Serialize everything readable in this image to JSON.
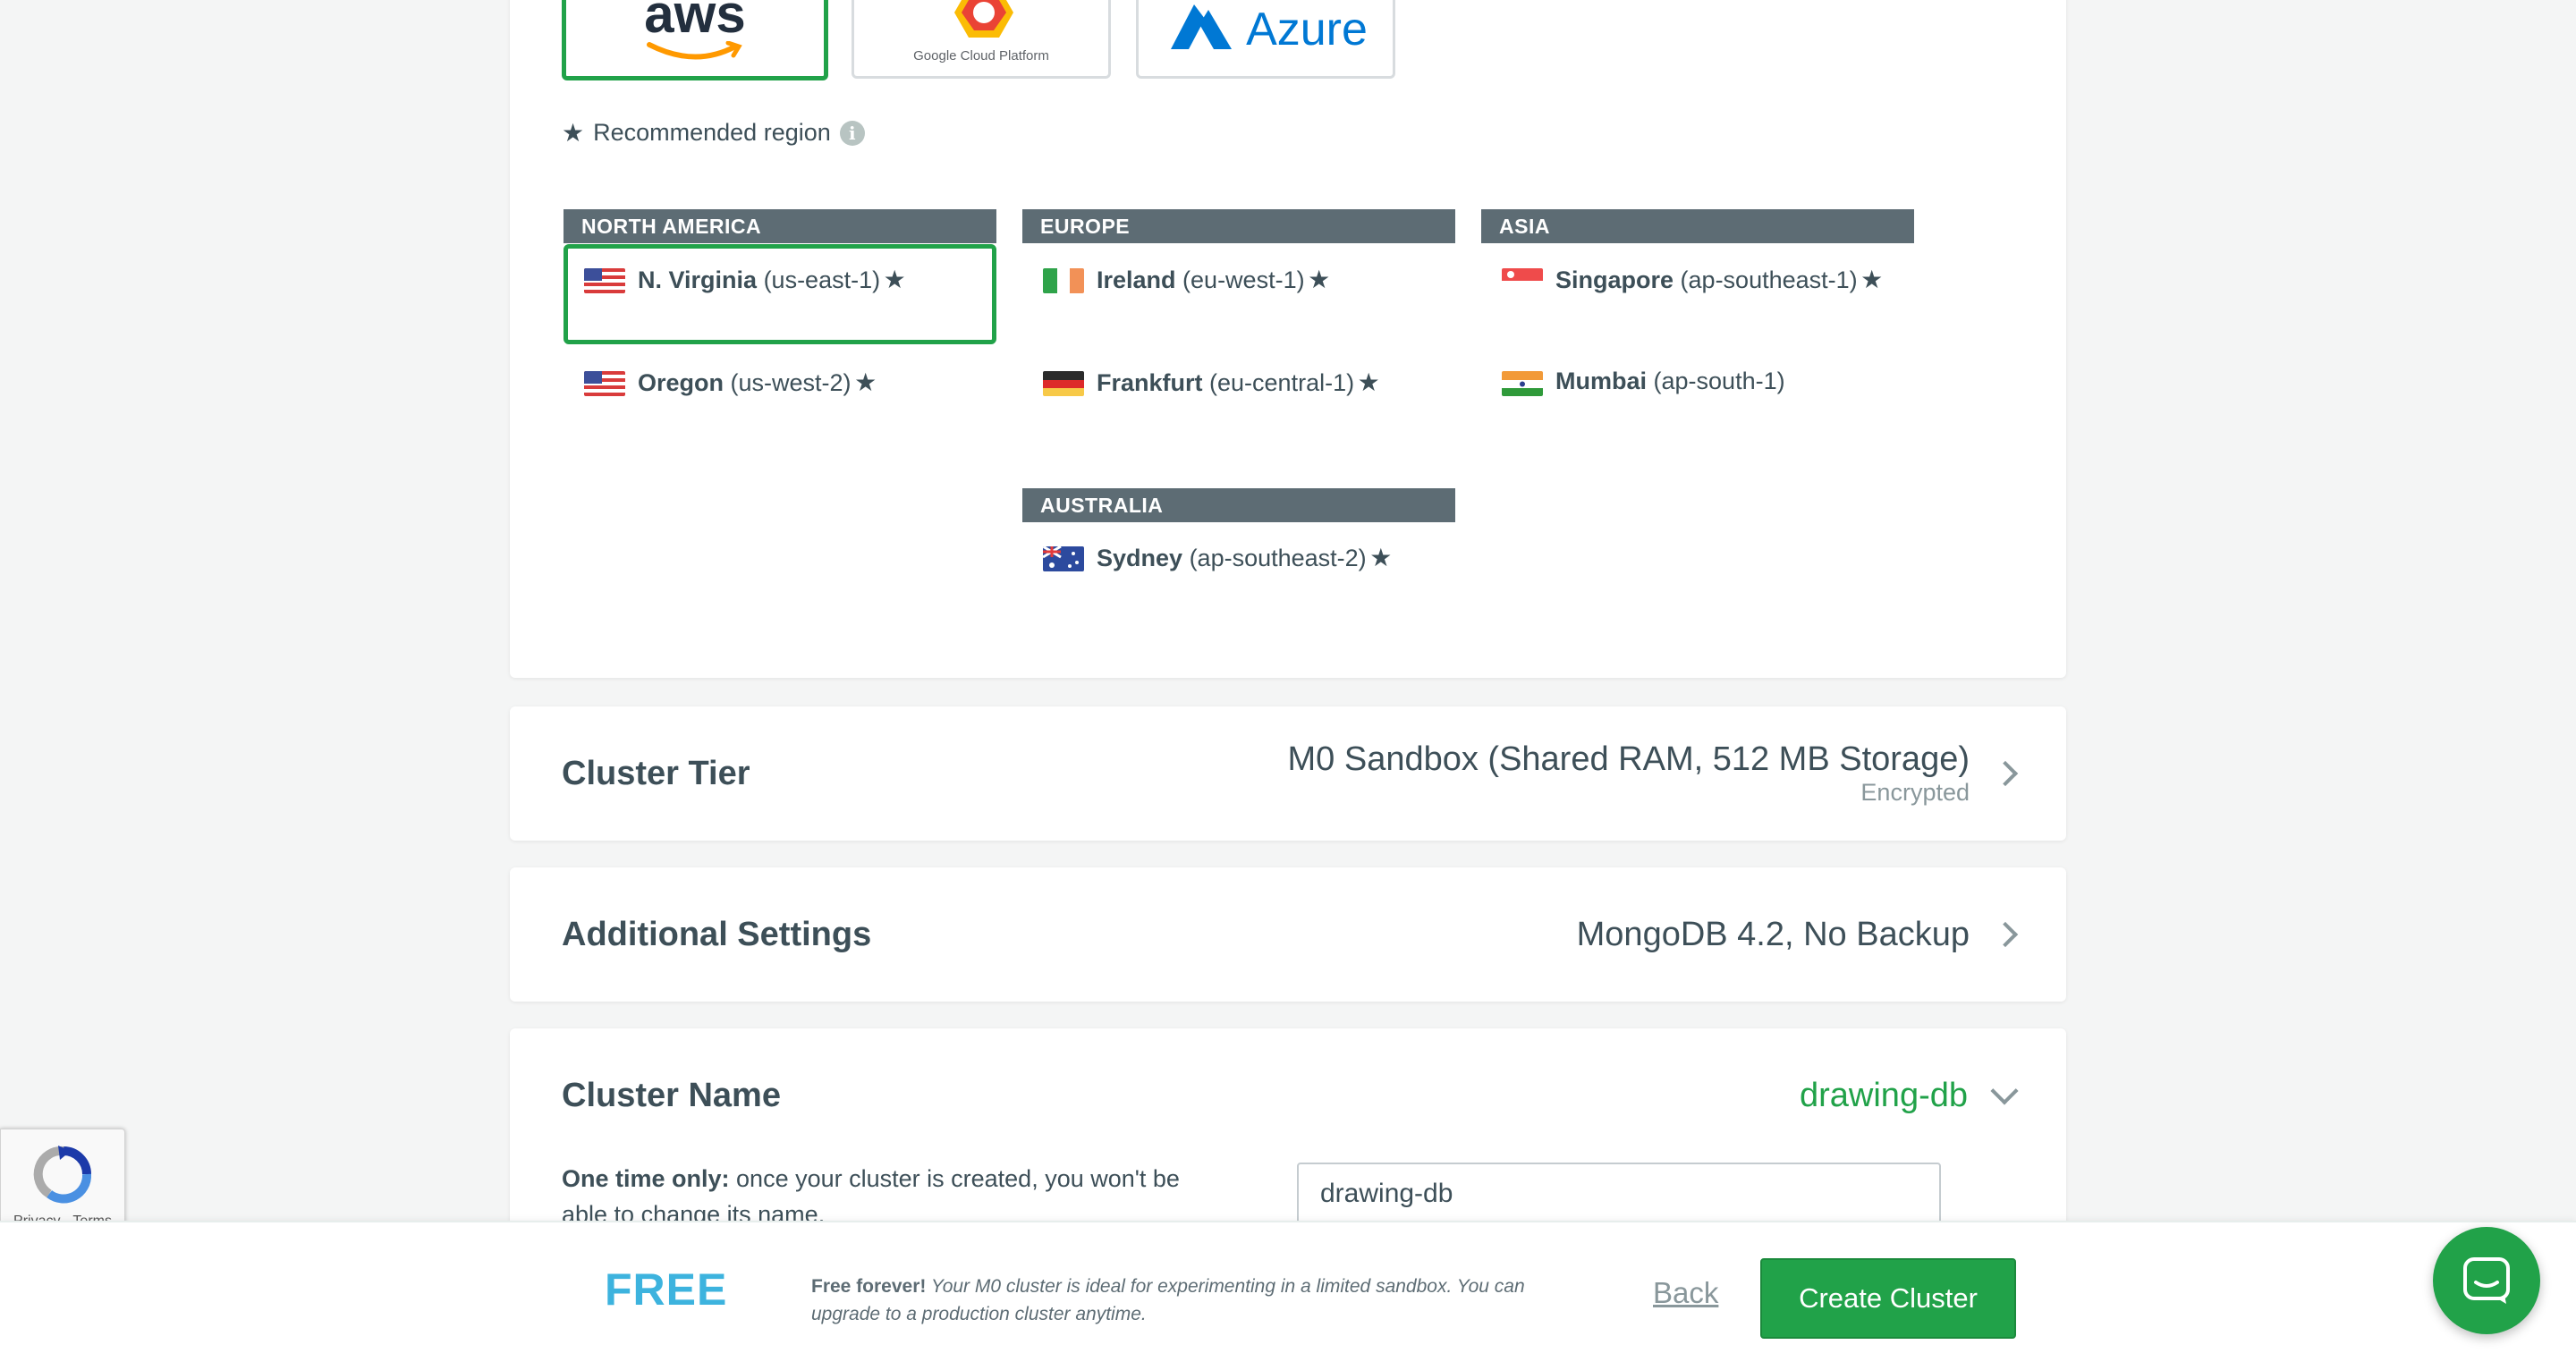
{
  "providers": {
    "aws": {
      "label": "aws",
      "selected": true
    },
    "gcp": {
      "label": "Google Cloud Platform"
    },
    "azure": {
      "label": "Azure"
    }
  },
  "recommended": {
    "label": "Recommended region"
  },
  "regions": {
    "north_america": {
      "header": "NORTH AMERICA",
      "items": [
        {
          "name": "N. Virginia",
          "code": "(us-east-1)",
          "recommended": true,
          "flag": "us-flag",
          "selected": true
        },
        {
          "name": "Oregon",
          "code": "(us-west-2)",
          "recommended": true,
          "flag": "us-flag"
        }
      ]
    },
    "europe": {
      "header": "EUROPE",
      "items": [
        {
          "name": "Ireland",
          "code": "(eu-west-1)",
          "recommended": true,
          "flag": "ireland-flag"
        },
        {
          "name": "Frankfurt",
          "code": "(eu-central-1)",
          "recommended": true,
          "flag": "germany-flag"
        }
      ]
    },
    "asia": {
      "header": "ASIA",
      "items": [
        {
          "name": "Singapore",
          "code": "(ap-southeast-1)",
          "recommended": true,
          "flag": "singapore-flag"
        },
        {
          "name": "Mumbai",
          "code": "(ap-south-1)",
          "recommended": false,
          "flag": "india-flag"
        }
      ]
    },
    "australia": {
      "header": "AUSTRALIA",
      "items": [
        {
          "name": "Sydney",
          "code": "(ap-southeast-2)",
          "recommended": true,
          "flag": "australia-flag"
        }
      ]
    }
  },
  "cluster_tier": {
    "title": "Cluster Tier",
    "value": "M0 Sandbox (Shared RAM, 512 MB Storage)",
    "sub": "Encrypted"
  },
  "additional_settings": {
    "title": "Additional Settings",
    "value": "MongoDB 4.2, No Backup"
  },
  "cluster_name": {
    "title": "Cluster Name",
    "value": "drawing-db",
    "note_bold": "One time only:",
    "note_text": " once your cluster is created, you won't be able to change its name.",
    "input_value": "drawing-db"
  },
  "footer": {
    "tier_label": "FREE",
    "desc_bold": "Free forever!",
    "desc_text": " Your M0 cluster is ideal for experimenting in a limited sandbox. You can upgrade to a production cluster anytime.",
    "back_label": "Back",
    "create_label": "Create Cluster"
  },
  "recaptcha": {
    "links": "Privacy - Terms"
  },
  "colors": {
    "accent_green": "#21a249",
    "free_blue": "#3db3de",
    "header_gray": "#5d6c74",
    "text": "#3d4f58"
  }
}
